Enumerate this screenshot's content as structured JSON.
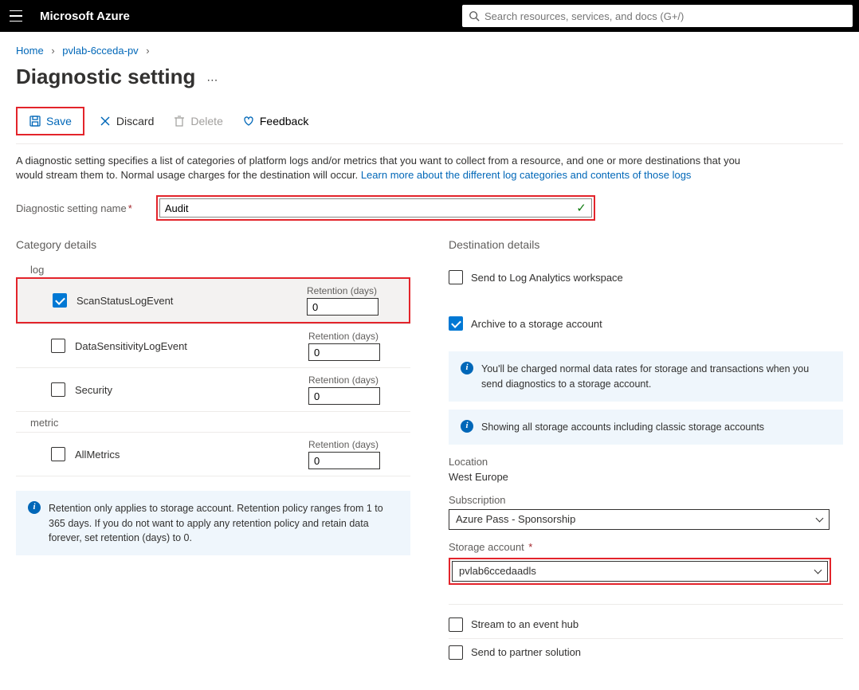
{
  "header": {
    "brand": "Microsoft Azure",
    "search_placeholder": "Search resources, services, and docs (G+/)"
  },
  "breadcrumbs": {
    "home": "Home",
    "resource": "pvlab-6cceda-pv"
  },
  "page": {
    "title": "Diagnostic setting",
    "toolbar": {
      "save": "Save",
      "discard": "Discard",
      "delete": "Delete",
      "feedback": "Feedback"
    },
    "intro_pre": "A diagnostic setting specifies a list of categories of platform logs and/or metrics that you want to collect from a resource, and one or more destinations that you would stream them to. Normal usage charges for the destination will occur. ",
    "intro_link": "Learn more about the different log categories and contents of those logs",
    "name_label": "Diagnostic setting name",
    "name_value": "Audit"
  },
  "category": {
    "heading": "Category details",
    "log_label": "log",
    "metric_label": "metric",
    "retention_label": "Retention (days)",
    "logs": [
      {
        "label": "ScanStatusLogEvent",
        "checked": true,
        "retention": "0"
      },
      {
        "label": "DataSensitivityLogEvent",
        "checked": false,
        "retention": "0"
      },
      {
        "label": "Security",
        "checked": false,
        "retention": "0"
      }
    ],
    "metrics": [
      {
        "label": "AllMetrics",
        "checked": false,
        "retention": "0"
      }
    ],
    "info": "Retention only applies to storage account. Retention policy ranges from 1 to 365 days. If you do not want to apply any retention policy and retain data forever, set retention (days) to 0."
  },
  "destination": {
    "heading": "Destination details",
    "log_analytics": {
      "label": "Send to Log Analytics workspace",
      "checked": false
    },
    "archive": {
      "label": "Archive to a storage account",
      "checked": true,
      "info1": "You'll be charged normal data rates for storage and transactions when you send diagnostics to a storage account.",
      "info2": "Showing all storage accounts including classic storage accounts",
      "location_label": "Location",
      "location_value": "West Europe",
      "subscription_label": "Subscription",
      "subscription_value": "Azure Pass - Sponsorship",
      "storage_label": "Storage account",
      "storage_value": "pvlab6ccedaadls"
    },
    "event_hub": {
      "label": "Stream to an event hub",
      "checked": false
    },
    "partner": {
      "label": "Send to partner solution",
      "checked": false
    }
  }
}
